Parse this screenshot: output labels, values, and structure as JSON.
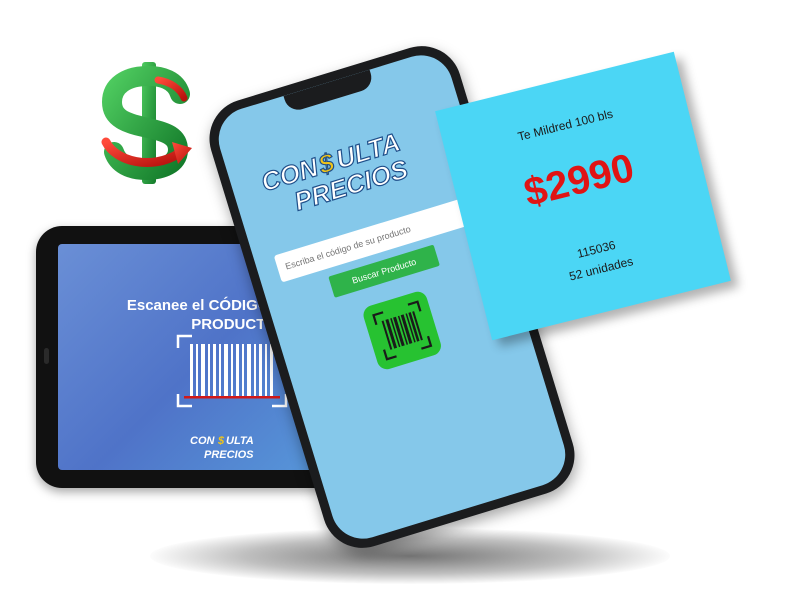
{
  "dollar_logo": {
    "symbol": "$",
    "colors": {
      "green": "#1d9e3a",
      "red": "#e0231a"
    }
  },
  "tablet": {
    "title_line1": "Escanee el CÓDIGO de barras",
    "title_line2": "PRODUCTO",
    "logo": {
      "line1_a": "CON",
      "line1_b": "ULTA",
      "line2": "PRECIOS"
    },
    "scan_line_color": "#d21818"
  },
  "phone": {
    "logo": {
      "line1_a": "CON",
      "line1_b": "ULTA",
      "line2": "PRECIOS"
    },
    "search_placeholder": "Escriba el código de su producto",
    "search_button_label": "Buscar Producto",
    "scan_button_icon": "barcode-scan-icon",
    "screen_color": "#85c8ea",
    "button_color": "#2fb34a"
  },
  "price_card": {
    "product_name": "Te Mildred 100 bls",
    "price": "$2990",
    "code": "115036",
    "units": "52 unidades",
    "background": "#4bd6f5",
    "price_color": "#e01414"
  }
}
